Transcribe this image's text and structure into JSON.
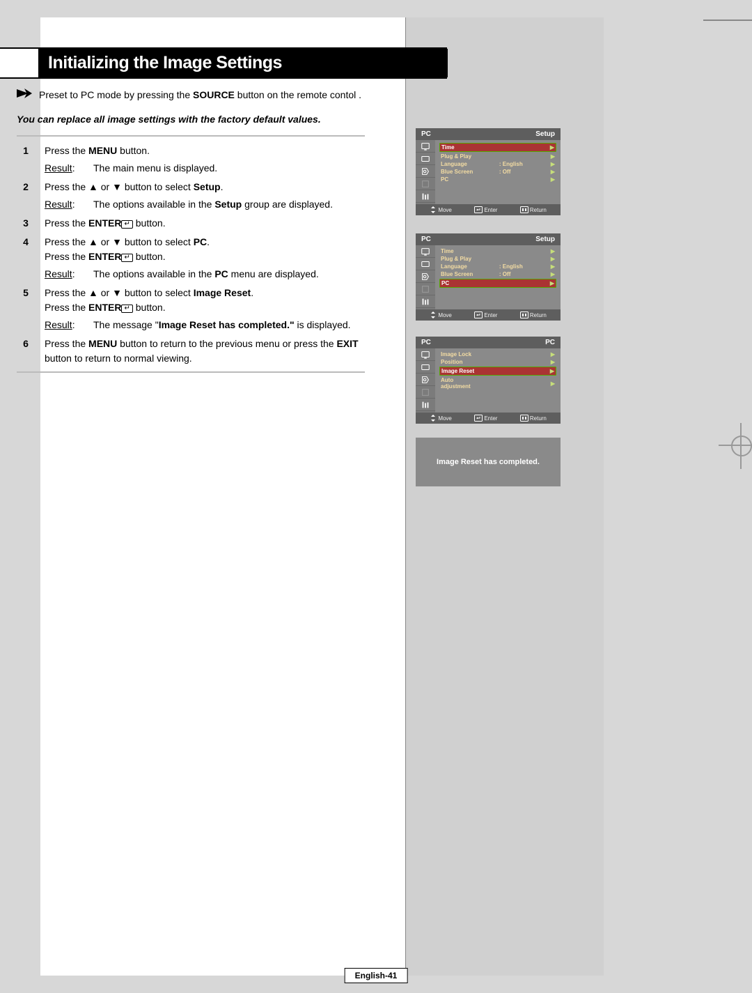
{
  "page": {
    "title": "Initializing the Image Settings",
    "note": {
      "pre": "Preset to PC mode by pressing the ",
      "bold": "SOURCE",
      "post": " button on the remote contol ."
    },
    "intro": "You can replace all image settings with the factory default values.",
    "steps": [
      {
        "num": "1",
        "lines": [
          {
            "pre": "Press the ",
            "b": "MENU",
            "post": " button."
          }
        ],
        "result": {
          "text": "The main menu is displayed."
        }
      },
      {
        "num": "2",
        "lines": [
          {
            "pre": "Press the ▲ or ▼ button to select ",
            "b": "Setup",
            "post": "."
          }
        ],
        "result": {
          "pre": "The options available in the ",
          "b": "Setup",
          "post": " group are displayed."
        }
      },
      {
        "num": "3",
        "lines": [
          {
            "pre": "Press the ",
            "b": "ENTER",
            "enter": true,
            "post": " button."
          }
        ]
      },
      {
        "num": "4",
        "lines": [
          {
            "pre": "Press the ▲ or ▼ button to select ",
            "b": "PC",
            "post": "."
          },
          {
            "pre": "Press the ",
            "b": "ENTER",
            "enter": true,
            "post": " button."
          }
        ],
        "result": {
          "pre": "The options available in the ",
          "b": "PC",
          "post": " menu are displayed."
        }
      },
      {
        "num": "5",
        "lines": [
          {
            "pre": "Press the ▲ or ▼ button to select ",
            "b": "Image Reset",
            "post": "."
          },
          {
            "pre": "Press the ",
            "b": "ENTER",
            "enter": true,
            "post": " button."
          }
        ],
        "result": {
          "pre": "The message \"",
          "b": "Image Reset has completed.\"",
          "post": " is displayed."
        }
      },
      {
        "num": "6",
        "lines": [
          {
            "pre": "Press the ",
            "b": "MENU",
            "post": " button to return to the previous menu or press the ",
            "b2": "EXIT",
            "post2": " button to return to normal viewing."
          }
        ]
      }
    ],
    "result_label": "Result"
  },
  "osd": {
    "foot": {
      "move": "Move",
      "enter": "Enter",
      "return": "Return"
    },
    "screens": [
      {
        "left": "PC",
        "right": "Setup",
        "hi": 0,
        "rows": [
          {
            "l": "Time",
            "v": "",
            "arrow": true,
            "hl": true
          },
          {
            "l": "Plug & Play",
            "v": "",
            "arrow": true
          },
          {
            "l": "Language",
            "v": ":   English",
            "arrow": true
          },
          {
            "l": "Blue Screen",
            "v": ":   Off",
            "arrow": true
          },
          {
            "l": "PC",
            "v": "",
            "arrow": true
          }
        ]
      },
      {
        "left": "PC",
        "right": "Setup",
        "hi": 4,
        "rows": [
          {
            "l": "Time",
            "v": "",
            "arrow": true
          },
          {
            "l": "Plug & Play",
            "v": "",
            "arrow": true
          },
          {
            "l": "Language",
            "v": ":   English",
            "arrow": true
          },
          {
            "l": "Blue Screen",
            "v": ":   Off",
            "arrow": true
          },
          {
            "l": "PC",
            "v": "",
            "arrow": true,
            "hl": true
          }
        ]
      },
      {
        "left": "PC",
        "right": "PC",
        "hi": 2,
        "rows": [
          {
            "l": "Image Lock",
            "v": "",
            "arrow": true
          },
          {
            "l": "Position",
            "v": "",
            "arrow": true
          },
          {
            "l": "Image Reset",
            "v": "",
            "arrow": true,
            "hl": true
          },
          {
            "l": "Auto adjustment",
            "v": "",
            "arrow": true
          }
        ]
      }
    ],
    "message": "Image Reset has completed."
  },
  "footer": {
    "pagenum": "English-41"
  }
}
